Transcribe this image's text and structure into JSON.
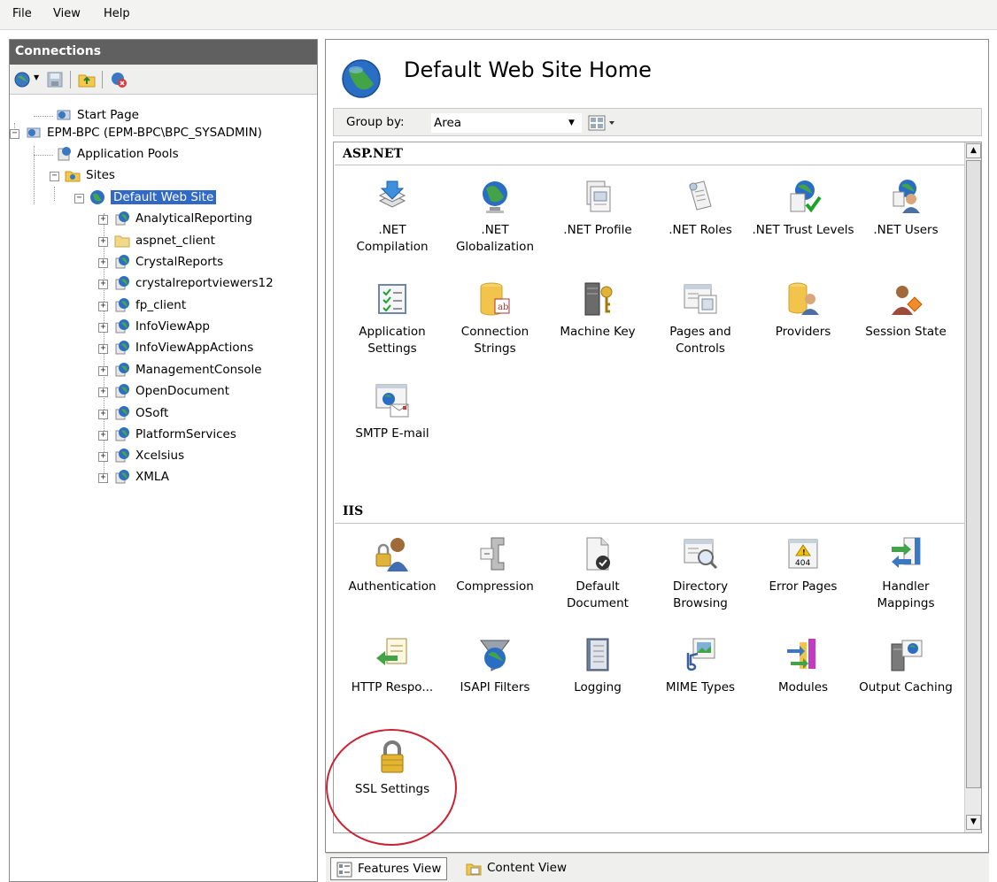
{
  "menu": [
    "File",
    "View",
    "Help"
  ],
  "connections": {
    "title": "Connections",
    "tree": [
      {
        "label": "Start Page",
        "icon": "server-icon",
        "level": 1
      },
      {
        "label": "EPM-BPC (EPM-BPC\\BPC_SYSADMIN)",
        "icon": "server-icon",
        "level": 0
      },
      {
        "label": "Application Pools",
        "icon": "app-pool-icon",
        "level": 1
      },
      {
        "label": "Sites",
        "icon": "sites-folder-icon",
        "level": 1
      },
      {
        "label": "Default Web Site",
        "icon": "globe-icon",
        "level": 2,
        "selected": true
      },
      {
        "label": "AnalyticalReporting",
        "icon": "app-globe-icon",
        "level": 3
      },
      {
        "label": "aspnet_client",
        "icon": "folder-icon",
        "level": 3
      },
      {
        "label": "CrystalReports",
        "icon": "app-globe-icon",
        "level": 3
      },
      {
        "label": "crystalreportviewers12",
        "icon": "app-globe-icon",
        "level": 3
      },
      {
        "label": "fp_client",
        "icon": "app-globe-icon",
        "level": 3
      },
      {
        "label": "InfoViewApp",
        "icon": "app-globe-icon",
        "level": 3
      },
      {
        "label": "InfoViewAppActions",
        "icon": "app-globe-icon",
        "level": 3
      },
      {
        "label": "ManagementConsole",
        "icon": "app-globe-icon",
        "level": 3
      },
      {
        "label": "OpenDocument",
        "icon": "app-globe-icon",
        "level": 3
      },
      {
        "label": "OSoft",
        "icon": "app-globe-icon",
        "level": 3
      },
      {
        "label": "PlatformServices",
        "icon": "app-globe-icon",
        "level": 3
      },
      {
        "label": "Xcelsius",
        "icon": "app-globe-icon",
        "level": 3
      },
      {
        "label": "XMLA",
        "icon": "app-globe-icon",
        "level": 3
      }
    ]
  },
  "main": {
    "title": "Default Web Site Home",
    "group_by_label": "Group by:",
    "group_by_value": "Area",
    "sections": [
      {
        "name": "ASP.NET",
        "items": [
          {
            "label": ".NET Compilation",
            "icon": "net-compilation-icon"
          },
          {
            "label": ".NET Globalization",
            "icon": "net-globalization-icon"
          },
          {
            "label": ".NET Profile",
            "icon": "net-profile-icon"
          },
          {
            "label": ".NET Roles",
            "icon": "net-roles-icon"
          },
          {
            "label": ".NET Trust Levels",
            "icon": "net-trust-levels-icon"
          },
          {
            "label": ".NET Users",
            "icon": "net-users-icon"
          },
          {
            "label": "Application Settings",
            "icon": "application-settings-icon"
          },
          {
            "label": "Connection Strings",
            "icon": "connection-strings-icon"
          },
          {
            "label": "Machine Key",
            "icon": "machine-key-icon"
          },
          {
            "label": "Pages and Controls",
            "icon": "pages-controls-icon"
          },
          {
            "label": "Providers",
            "icon": "providers-icon"
          },
          {
            "label": "Session State",
            "icon": "session-state-icon"
          },
          {
            "label": "SMTP E-mail",
            "icon": "smtp-email-icon"
          }
        ]
      },
      {
        "name": "IIS",
        "items": [
          {
            "label": "Authentication",
            "icon": "authentication-icon"
          },
          {
            "label": "Compression",
            "icon": "compression-icon"
          },
          {
            "label": "Default Document",
            "icon": "default-document-icon"
          },
          {
            "label": "Directory Browsing",
            "icon": "directory-browsing-icon"
          },
          {
            "label": "Error Pages",
            "icon": "error-pages-icon"
          },
          {
            "label": "Handler Mappings",
            "icon": "handler-mappings-icon"
          },
          {
            "label": "HTTP Respo...",
            "icon": "http-response-icon"
          },
          {
            "label": "ISAPI Filters",
            "icon": "isapi-filters-icon"
          },
          {
            "label": "Logging",
            "icon": "logging-icon"
          },
          {
            "label": "MIME Types",
            "icon": "mime-types-icon"
          },
          {
            "label": "Modules",
            "icon": "modules-icon"
          },
          {
            "label": "Output Caching",
            "icon": "output-caching-icon"
          },
          {
            "label": "SSL Settings",
            "icon": "ssl-settings-icon"
          }
        ]
      }
    ]
  },
  "view_tabs": {
    "features": "Features View",
    "content": "Content View"
  },
  "colors": {
    "selection": "#3169c6",
    "annotation": "#cc2233",
    "header": "#606060"
  }
}
